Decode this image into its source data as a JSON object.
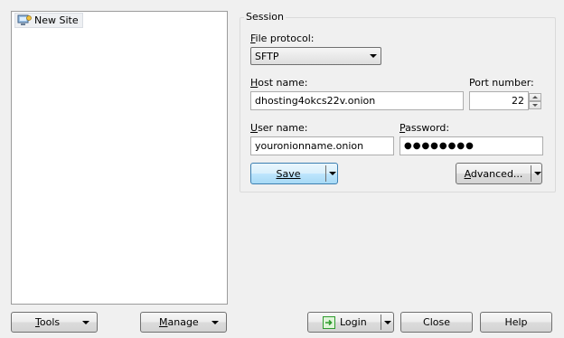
{
  "site_tree": {
    "items": [
      {
        "label": "New Site",
        "icon": "computer-network-icon"
      }
    ]
  },
  "session": {
    "legend": "Session",
    "file_protocol": {
      "label_hot": "F",
      "label_rest": "ile protocol:",
      "value": "SFTP"
    },
    "host": {
      "label_hot": "H",
      "label_rest": "ost name:",
      "value": "dhosting4okcs22v.onion"
    },
    "port": {
      "label": "Port number:",
      "value": "22"
    },
    "user": {
      "label_hot": "U",
      "label_rest": "ser name:",
      "value": "youronionname.onion"
    },
    "password": {
      "label_hot": "P",
      "label_rest": "assword:",
      "value": "●●●●●●●●"
    },
    "save_hot": "S",
    "save_rest": "ave",
    "advanced_hot": "A",
    "advanced_rest": "dvanced..."
  },
  "bottom": {
    "tools_hot": "T",
    "tools_rest": "ools",
    "manage_hot": "M",
    "manage_rest": "anage",
    "login": "Login",
    "close": "Close",
    "help": "Help"
  },
  "colors": {
    "login_icon": "#2e9b2e",
    "focus_border": "#3c7fb1"
  }
}
